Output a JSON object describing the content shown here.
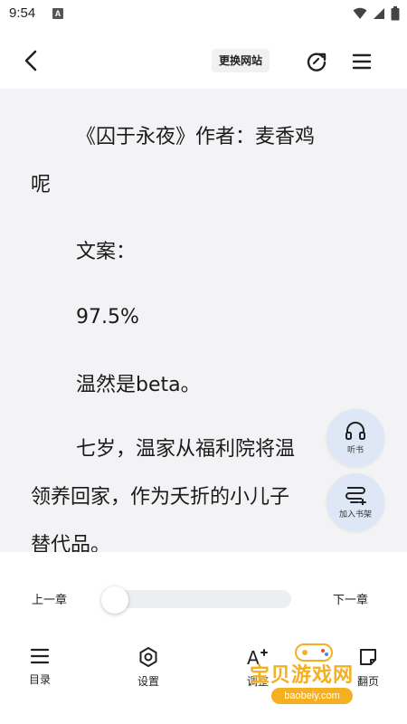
{
  "status_bar": {
    "time": "9:54",
    "notification_icon": "A"
  },
  "toolbar": {
    "switch_site_label": "更换网站"
  },
  "content": {
    "paragraphs": [
      "《囚于永夜》作者：麦香鸡",
      "呢",
      "文案：",
      "97.5%",
      "温然是beta。",
      "七岁，温家从福利院将温",
      "领养回家，作为夭折的小儿子",
      "替代品。"
    ]
  },
  "fabs": {
    "listen_label": "听书",
    "add_shelf_label": "加入书架"
  },
  "chapter_nav": {
    "prev_label": "上一章",
    "next_label": "下一章",
    "progress": 0.0
  },
  "bottom_nav": {
    "toc_label": "目录",
    "settings_label": "设置",
    "font_label": "调整",
    "page_label": "翻页"
  },
  "watermark": {
    "text": "宝贝游戏网",
    "url": "baobeiy.com"
  },
  "colors": {
    "reader_bg": "#f3f3f5",
    "fab_bg": "#dce6f5",
    "watermark": "#f5b021"
  }
}
